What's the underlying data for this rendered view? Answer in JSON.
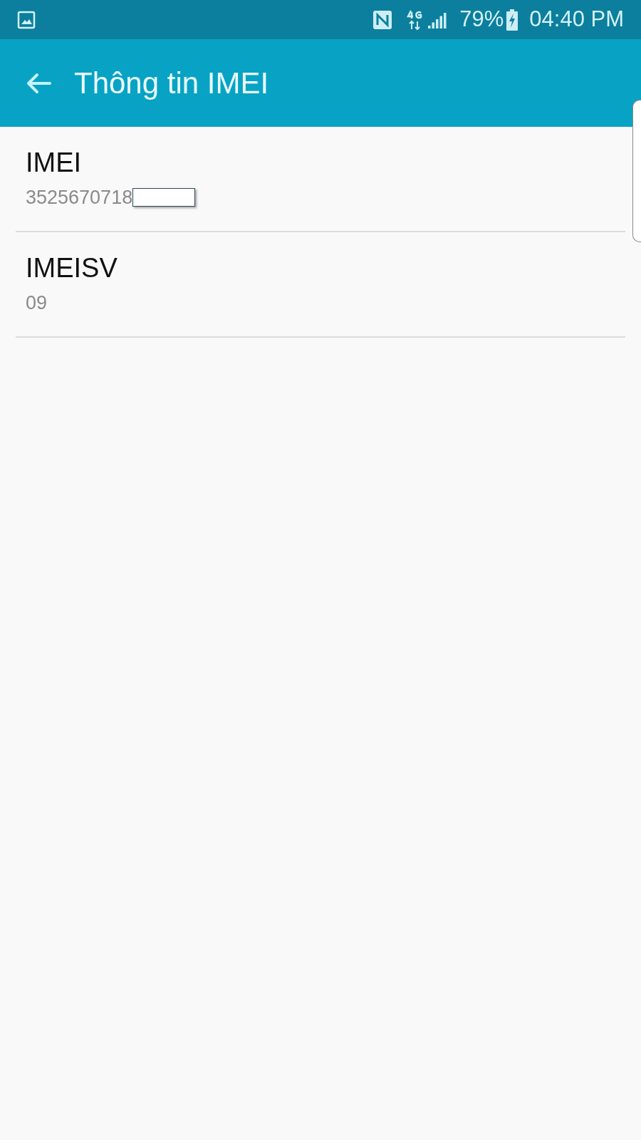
{
  "status_bar": {
    "battery": "79%",
    "time": "04:40 PM"
  },
  "app_bar": {
    "title": "Thông tin IMEI"
  },
  "items": [
    {
      "title": "IMEI",
      "value": "3525670718",
      "redacted": true
    },
    {
      "title": "IMEISV",
      "value": "09",
      "redacted": false
    }
  ]
}
